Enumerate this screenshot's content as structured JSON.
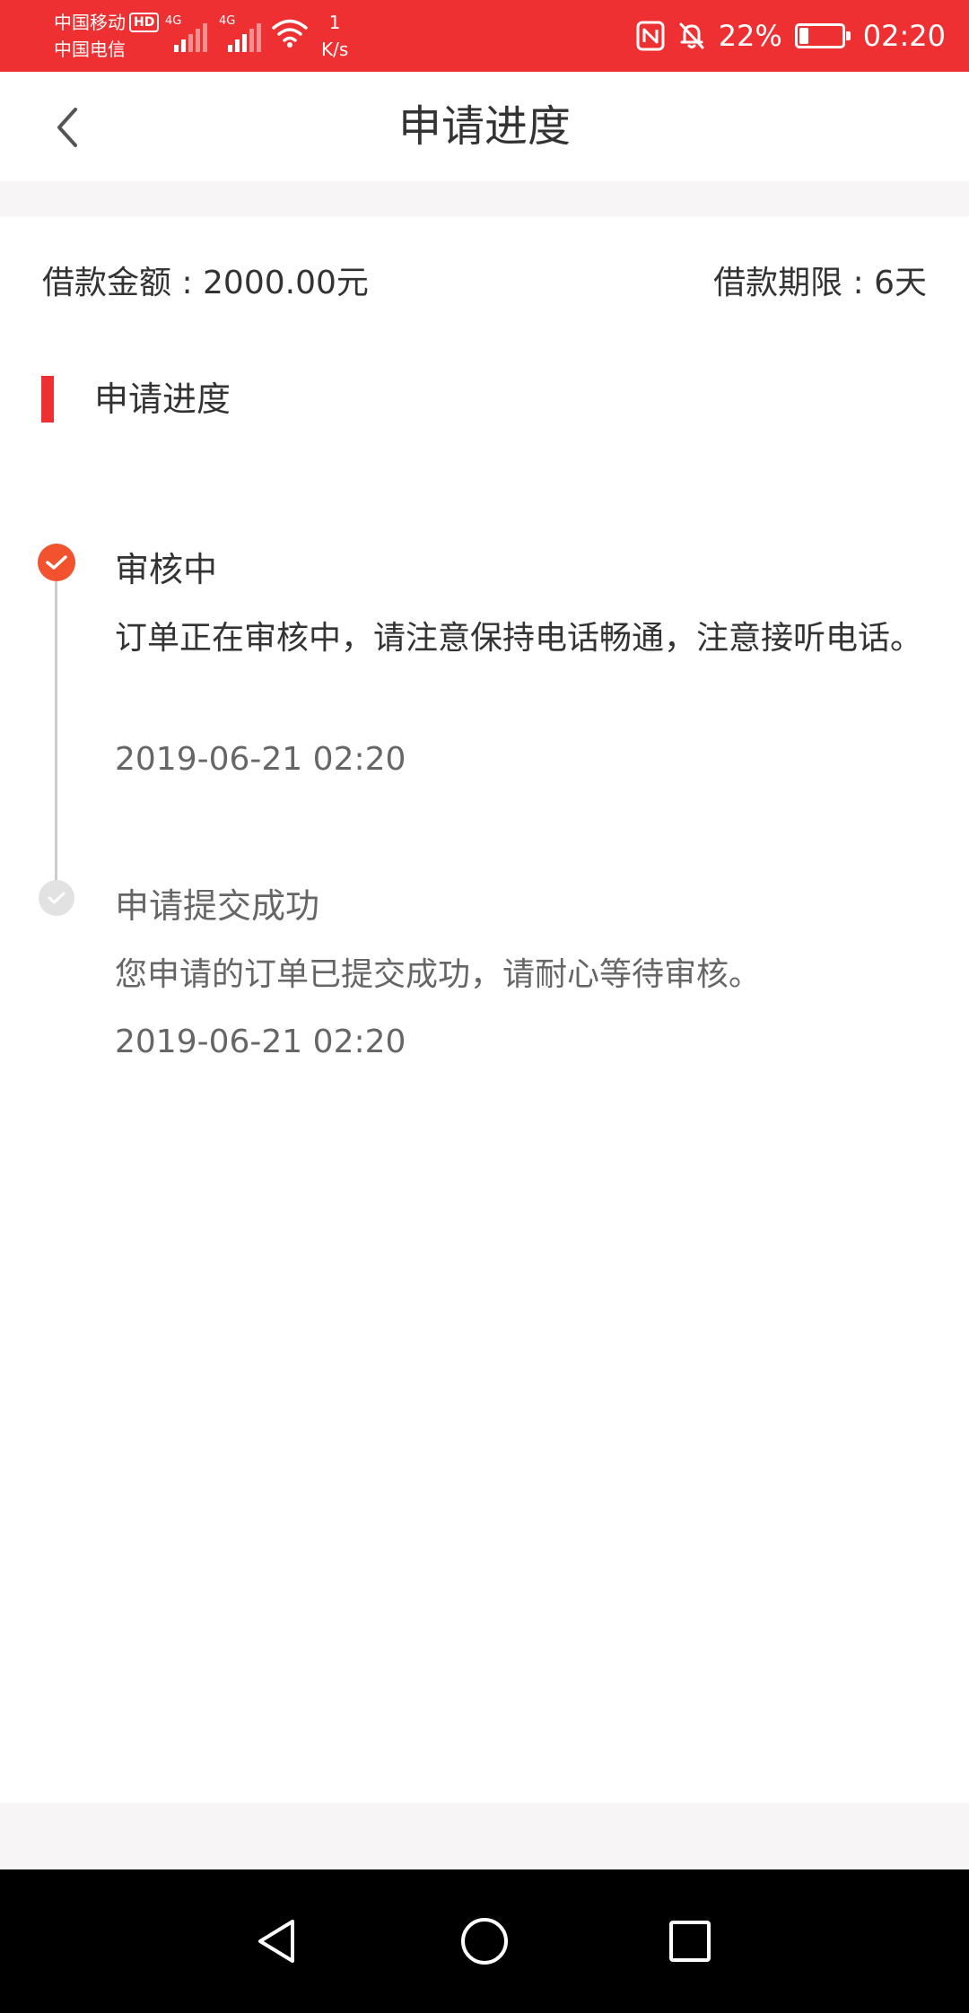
{
  "status_bar": {
    "carrier_1": "中国移动",
    "hd_badge": "HD",
    "carrier_2": "中国电信",
    "signal_1_type": "4G",
    "signal_2_type": "4G",
    "speed_value": "1",
    "speed_unit": "K/s",
    "battery_percent": "22%",
    "battery_level": 0.22,
    "time": "02:20"
  },
  "nav": {
    "title": "申请进度"
  },
  "summary": {
    "loan_amount": "借款金额 : 2000.00元",
    "loan_term": "借款期限 : 6天"
  },
  "section": {
    "title": "申请进度"
  },
  "timeline": [
    {
      "title": "审核中",
      "description": "订单正在审核中，请注意保持电话畅通，注意接听电话。",
      "time": "2019-06-21 02:20",
      "status": "active"
    },
    {
      "title": "申请提交成功",
      "description": "您申请的订单已提交成功，请耐心等待审核。",
      "time": "2019-06-21 02:20",
      "status": "done"
    }
  ],
  "colors": {
    "brand_red": "#ee3033",
    "active_dot": "#f2522d",
    "done_dot": "#e2e2e2"
  },
  "icons": {
    "back": "chevron-left-icon",
    "nfc": "nfc-icon",
    "mute": "bell-off-icon",
    "wifi": "wifi-icon",
    "check": "check-icon",
    "sys_back": "triangle-back-icon",
    "sys_home": "circle-home-icon",
    "sys_recent": "square-recent-icon"
  }
}
